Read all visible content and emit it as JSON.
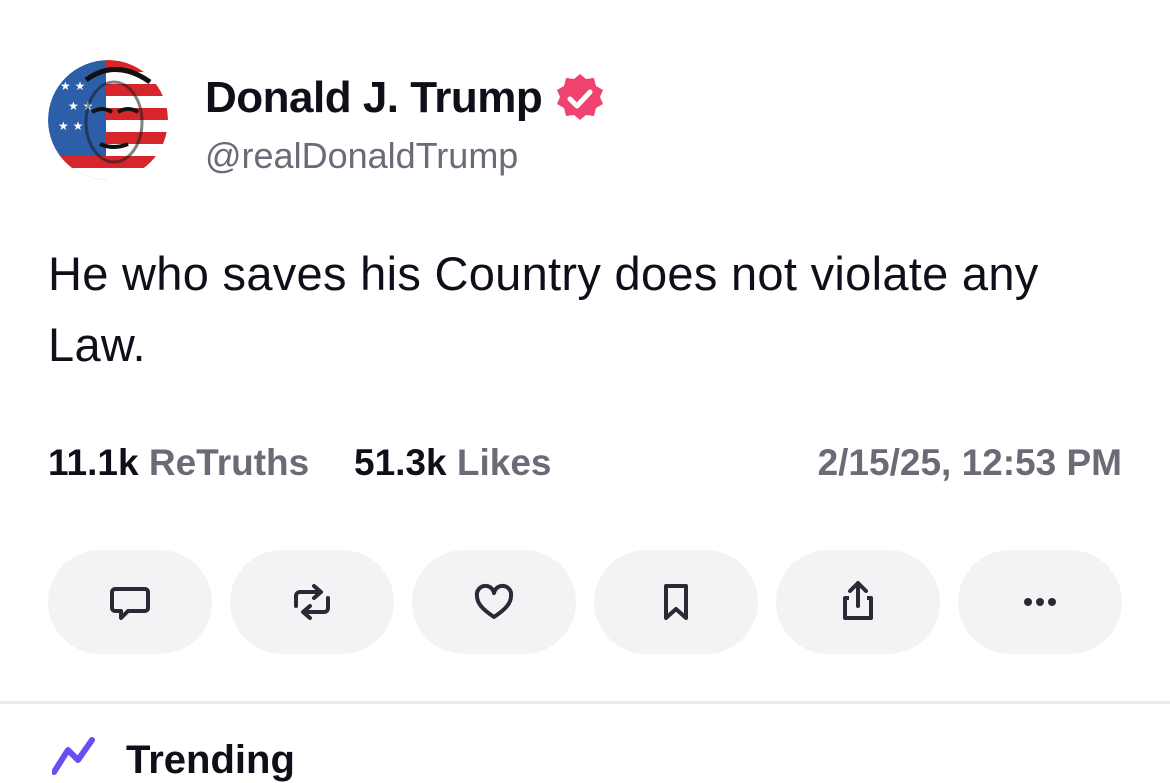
{
  "profile": {
    "display_name": "Donald J. Trump",
    "handle": "@realDonaldTrump",
    "verified": true,
    "avatar_icon": "avatar-flag-portrait",
    "verified_color": "#f0426e"
  },
  "post": {
    "text": "He who saves his Country does not violate any Law."
  },
  "stats": {
    "retruths_count": "11.1k",
    "retruths_label": "ReTruths",
    "likes_count": "51.3k",
    "likes_label": "Likes",
    "timestamp": "2/15/25, 12:53 PM"
  },
  "actions": [
    {
      "name": "reply",
      "icon": "comment-icon"
    },
    {
      "name": "retruth",
      "icon": "repost-icon"
    },
    {
      "name": "like",
      "icon": "heart-icon"
    },
    {
      "name": "bookmark",
      "icon": "bookmark-icon"
    },
    {
      "name": "share",
      "icon": "share-icon"
    },
    {
      "name": "more",
      "icon": "more-icon"
    }
  ],
  "trending": {
    "label": "Trending",
    "icon": "trending-icon",
    "icon_color": "#6b4ef0"
  }
}
